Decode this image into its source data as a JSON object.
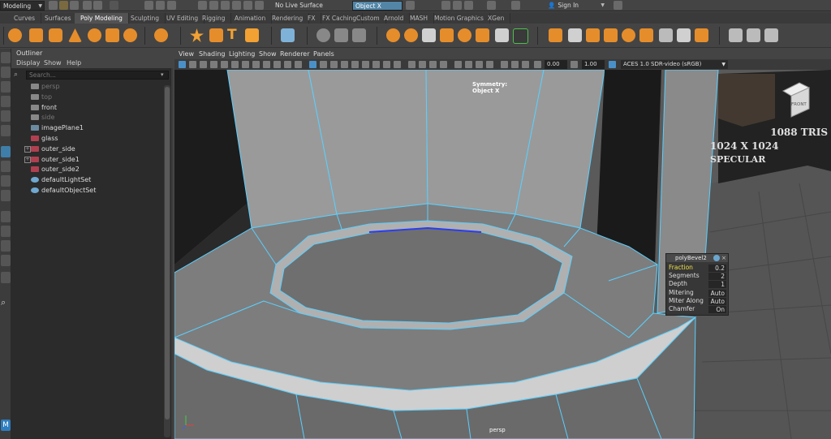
{
  "status": {
    "menuset": "Modeling",
    "live_surface": "No Live Surface",
    "symmetry_field": "Object X",
    "sign_in": "Sign In"
  },
  "shelf_tabs": [
    "Curves",
    "Surfaces",
    "Poly Modeling",
    "Sculpting",
    "UV Editing",
    "Rigging",
    "Animation",
    "Rendering",
    "FX",
    "FX Caching",
    "Custom",
    "Arnold",
    "MASH",
    "Motion Graphics",
    "XGen"
  ],
  "active_shelf_tab": "Poly Modeling",
  "outliner": {
    "title": "Outliner",
    "menus": [
      "Display",
      "Show",
      "Help"
    ],
    "search_placeholder": "Search...",
    "items": [
      {
        "label": "persp",
        "type": "camera",
        "dim": true,
        "expand": false
      },
      {
        "label": "top",
        "type": "camera",
        "dim": true,
        "expand": false
      },
      {
        "label": "front",
        "type": "camera",
        "dim": false,
        "expand": false
      },
      {
        "label": "side",
        "type": "camera",
        "dim": true,
        "expand": false
      },
      {
        "label": "imagePlane1",
        "type": "imageplane",
        "dim": false,
        "expand": false
      },
      {
        "label": "glass",
        "type": "mesh",
        "dim": false,
        "expand": false
      },
      {
        "label": "outer_side",
        "type": "mesh",
        "dim": false,
        "expand": true
      },
      {
        "label": "outer_side1",
        "type": "mesh",
        "dim": false,
        "expand": true
      },
      {
        "label": "outer_side2",
        "type": "mesh",
        "dim": false,
        "expand": false
      },
      {
        "label": "defaultLightSet",
        "type": "set",
        "dim": false,
        "expand": false
      },
      {
        "label": "defaultObjectSet",
        "type": "set",
        "dim": false,
        "expand": false
      }
    ]
  },
  "viewport": {
    "menus": [
      "View",
      "Shading",
      "Lighting",
      "Show",
      "Renderer",
      "Panels"
    ],
    "exposure": "0.00",
    "gamma": "1.00",
    "color_transform": "ACES 1.0 SDR-video (sRGB)",
    "symmetry_label": "Symmetry: Object X",
    "camera_label": "persp",
    "viewcube_label": "FRONT",
    "reference_text": [
      "1088 TRIS",
      "1024 X 1024",
      "SPECULAR"
    ]
  },
  "bevel": {
    "title": "polyBevel2",
    "rows": [
      {
        "label": "Fraction",
        "value": "0.2",
        "highlight": true
      },
      {
        "label": "Segments",
        "value": "2",
        "highlight": false
      },
      {
        "label": "Depth",
        "value": "1",
        "highlight": false
      },
      {
        "label": "Mitering",
        "value": "Auto",
        "highlight": false
      },
      {
        "label": "Miter Along",
        "value": "Auto",
        "highlight": false
      },
      {
        "label": "Chamfer",
        "value": "On",
        "highlight": false
      }
    ]
  },
  "colors": {
    "accent": "#5285a6",
    "wire": "#6ad6ff",
    "selected_edge": "#2a3df0",
    "highlight_label": "#f0e14a"
  }
}
